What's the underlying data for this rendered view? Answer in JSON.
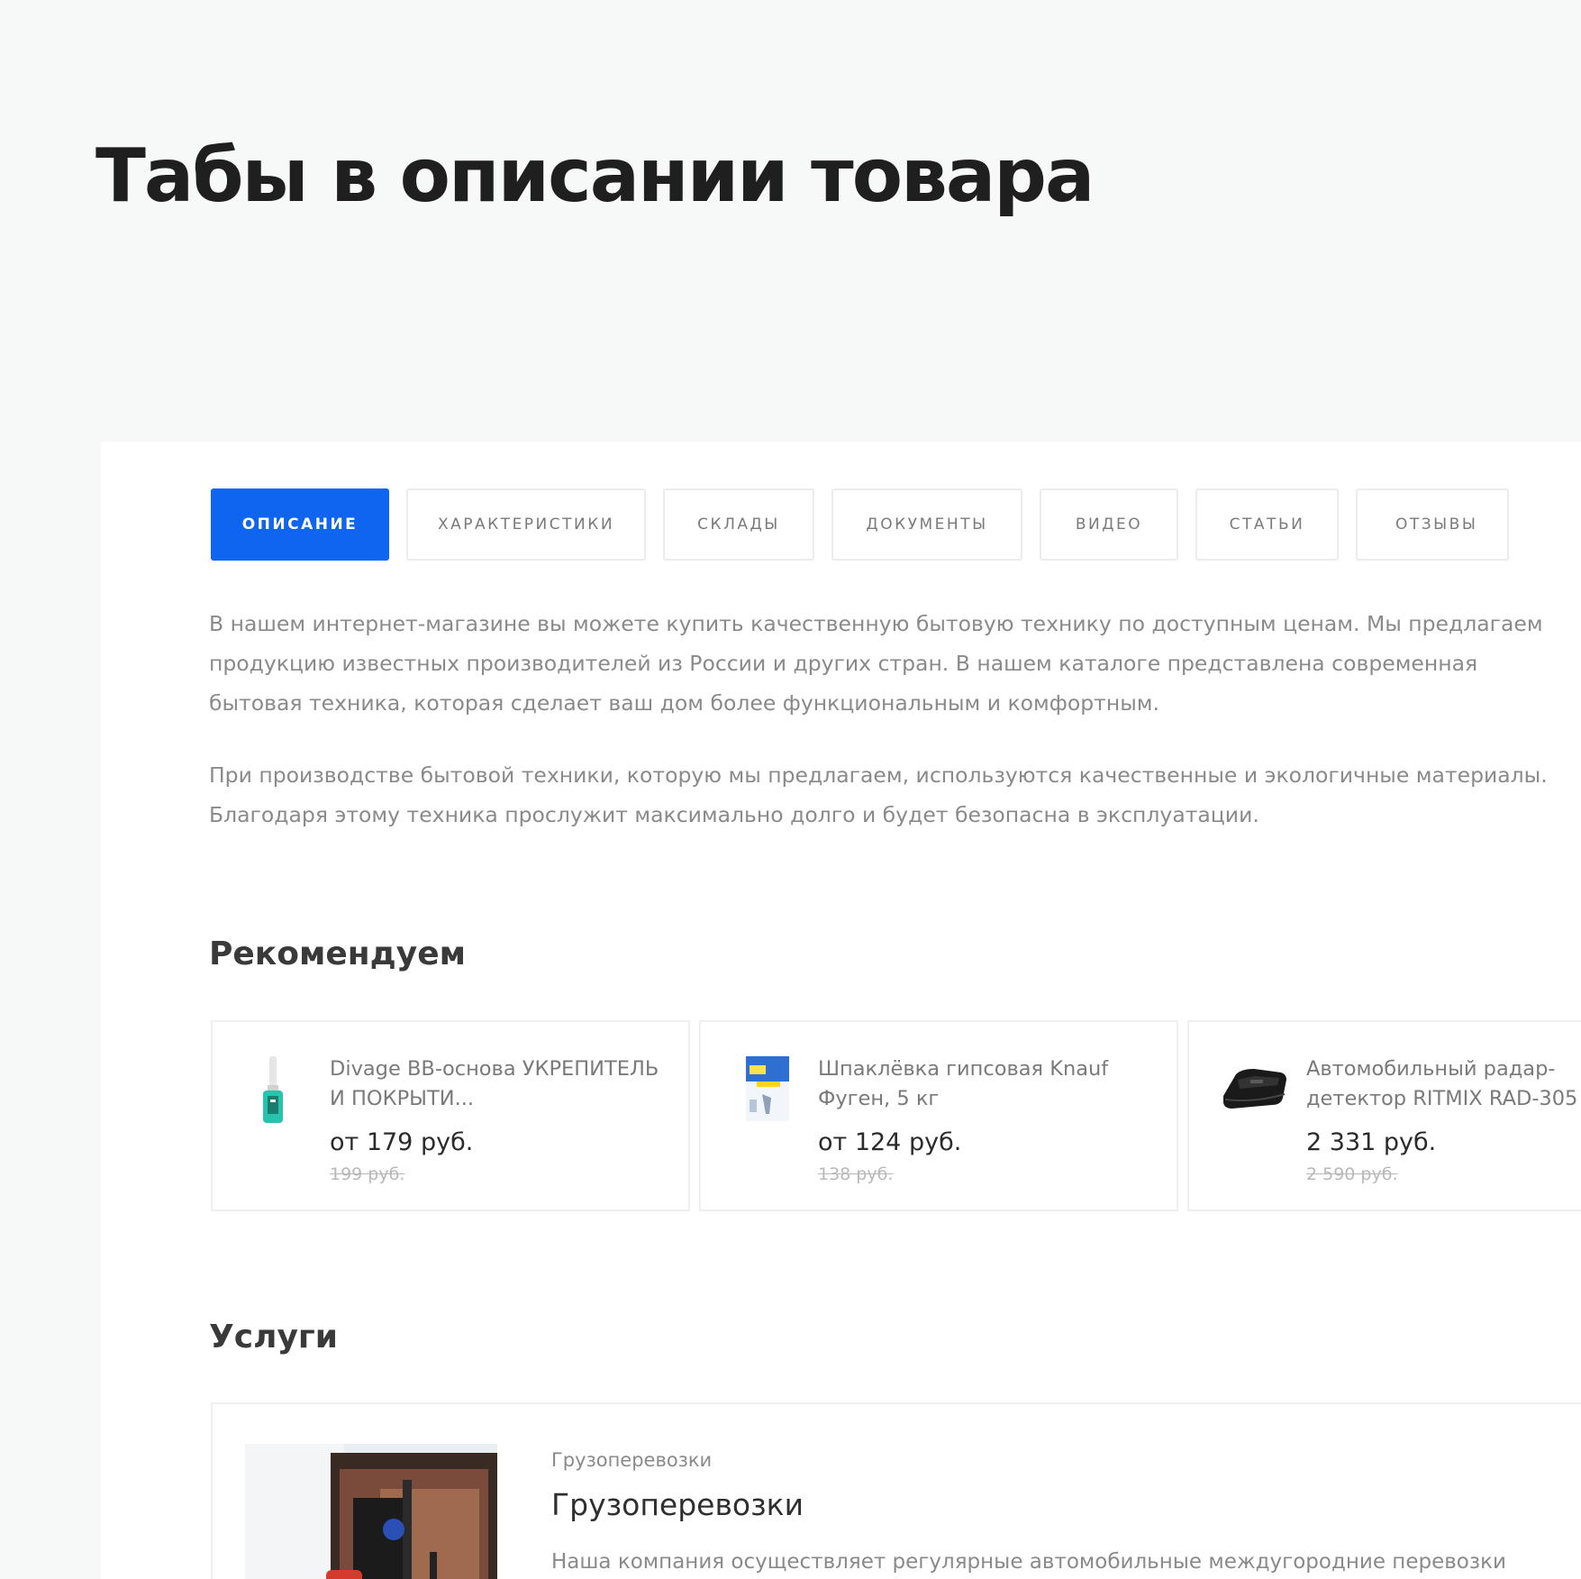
{
  "page": {
    "title": "Табы в описании товара"
  },
  "tabs": [
    {
      "label": "Описание",
      "active": true
    },
    {
      "label": "Характеристики",
      "active": false
    },
    {
      "label": "Склады",
      "active": false
    },
    {
      "label": "Документы",
      "active": false
    },
    {
      "label": "Видео",
      "active": false
    },
    {
      "label": "Статьи",
      "active": false
    },
    {
      "label": "Отзывы",
      "active": false
    }
  ],
  "description": {
    "paragraphs": [
      [
        "В нашем интернет-магазине вы можете купить качественную бытовую технику по доступным ценам. Мы предлагаем",
        "продукцию известных производителей из России и других стран. В нашем каталоге представлена современная",
        "бытовая техника, которая сделает ваш дом более функциональным и комфортным."
      ],
      [
        "При производстве бытовой техники, которую мы предлагаем, используются качественные и экологичные материалы.",
        "Благодаря этому техника прослужит максимально долго и будет безопасна в эксплуатации."
      ]
    ]
  },
  "recommended": {
    "title": "Рекомендуем",
    "products": [
      {
        "name": "Divage BB-основа УКРЕПИТЕЛЬ И ПОКРЫТИ...",
        "price": "от 179 руб.",
        "old_price": "199 руб.",
        "icon": "nail-polish-icon"
      },
      {
        "name": "Шпаклёвка гипсовая Knauf Фуген, 5 кг",
        "price": "от 124 руб.",
        "old_price": "138 руб.",
        "icon": "putty-bag-icon"
      },
      {
        "name": "Автомобильный радар-детектор RITMIX RAD-305",
        "price": "2 331 руб.",
        "old_price": "2 590 руб.",
        "icon": "radar-detector-icon"
      }
    ]
  },
  "services": {
    "title": "Услуги",
    "items": [
      {
        "category": "Грузоперевозки",
        "name": "Грузоперевозки",
        "text": "Наша компания осуществляет регулярные автомобильные междугородние перевозки",
        "icon": "forklift-truck-icon"
      }
    ]
  },
  "colors": {
    "accent": "#0f64f0",
    "background": "#f7f8f8",
    "card": "#ffffff"
  }
}
